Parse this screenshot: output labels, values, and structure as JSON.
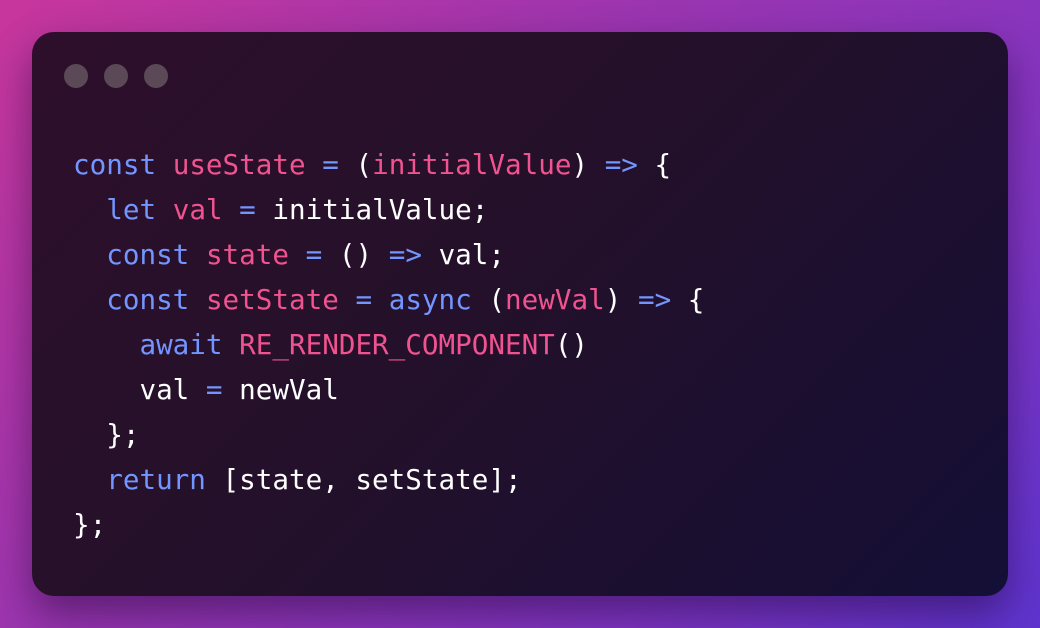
{
  "window": {
    "controls": [
      "dot",
      "dot",
      "dot"
    ]
  },
  "colors": {
    "keyword": "#7395ff",
    "identifier": "#f0538f",
    "plain": "#ffffff"
  },
  "code": {
    "lines": [
      [
        {
          "t": "const",
          "c": "kw"
        },
        {
          "t": " ",
          "c": "plain"
        },
        {
          "t": "useState",
          "c": "id"
        },
        {
          "t": " ",
          "c": "plain"
        },
        {
          "t": "=",
          "c": "op"
        },
        {
          "t": " (",
          "c": "plain"
        },
        {
          "t": "initialValue",
          "c": "id"
        },
        {
          "t": ") ",
          "c": "plain"
        },
        {
          "t": "=>",
          "c": "op"
        },
        {
          "t": " {",
          "c": "plain"
        }
      ],
      [
        {
          "t": "  ",
          "c": "plain"
        },
        {
          "t": "let",
          "c": "kw"
        },
        {
          "t": " ",
          "c": "plain"
        },
        {
          "t": "val",
          "c": "id"
        },
        {
          "t": " ",
          "c": "plain"
        },
        {
          "t": "=",
          "c": "op"
        },
        {
          "t": " initialValue;",
          "c": "plain"
        }
      ],
      [
        {
          "t": "  ",
          "c": "plain"
        },
        {
          "t": "const",
          "c": "kw"
        },
        {
          "t": " ",
          "c": "plain"
        },
        {
          "t": "state",
          "c": "id"
        },
        {
          "t": " ",
          "c": "plain"
        },
        {
          "t": "=",
          "c": "op"
        },
        {
          "t": " () ",
          "c": "plain"
        },
        {
          "t": "=>",
          "c": "op"
        },
        {
          "t": " val;",
          "c": "plain"
        }
      ],
      [
        {
          "t": "  ",
          "c": "plain"
        },
        {
          "t": "const",
          "c": "kw"
        },
        {
          "t": " ",
          "c": "plain"
        },
        {
          "t": "setState",
          "c": "id"
        },
        {
          "t": " ",
          "c": "plain"
        },
        {
          "t": "=",
          "c": "op"
        },
        {
          "t": " ",
          "c": "plain"
        },
        {
          "t": "async",
          "c": "kw"
        },
        {
          "t": " (",
          "c": "plain"
        },
        {
          "t": "newVal",
          "c": "id"
        },
        {
          "t": ") ",
          "c": "plain"
        },
        {
          "t": "=>",
          "c": "op"
        },
        {
          "t": " {",
          "c": "plain"
        }
      ],
      [
        {
          "t": "    ",
          "c": "plain"
        },
        {
          "t": "await",
          "c": "kw"
        },
        {
          "t": " ",
          "c": "plain"
        },
        {
          "t": "RE_RENDER_COMPONENT",
          "c": "id"
        },
        {
          "t": "()",
          "c": "plain"
        }
      ],
      [
        {
          "t": "    val ",
          "c": "plain"
        },
        {
          "t": "=",
          "c": "op"
        },
        {
          "t": " newVal",
          "c": "plain"
        }
      ],
      [
        {
          "t": "  };",
          "c": "plain"
        }
      ],
      [
        {
          "t": "  ",
          "c": "plain"
        },
        {
          "t": "return",
          "c": "kw"
        },
        {
          "t": " [state, setState];",
          "c": "plain"
        }
      ],
      [
        {
          "t": "};",
          "c": "plain"
        }
      ]
    ]
  }
}
